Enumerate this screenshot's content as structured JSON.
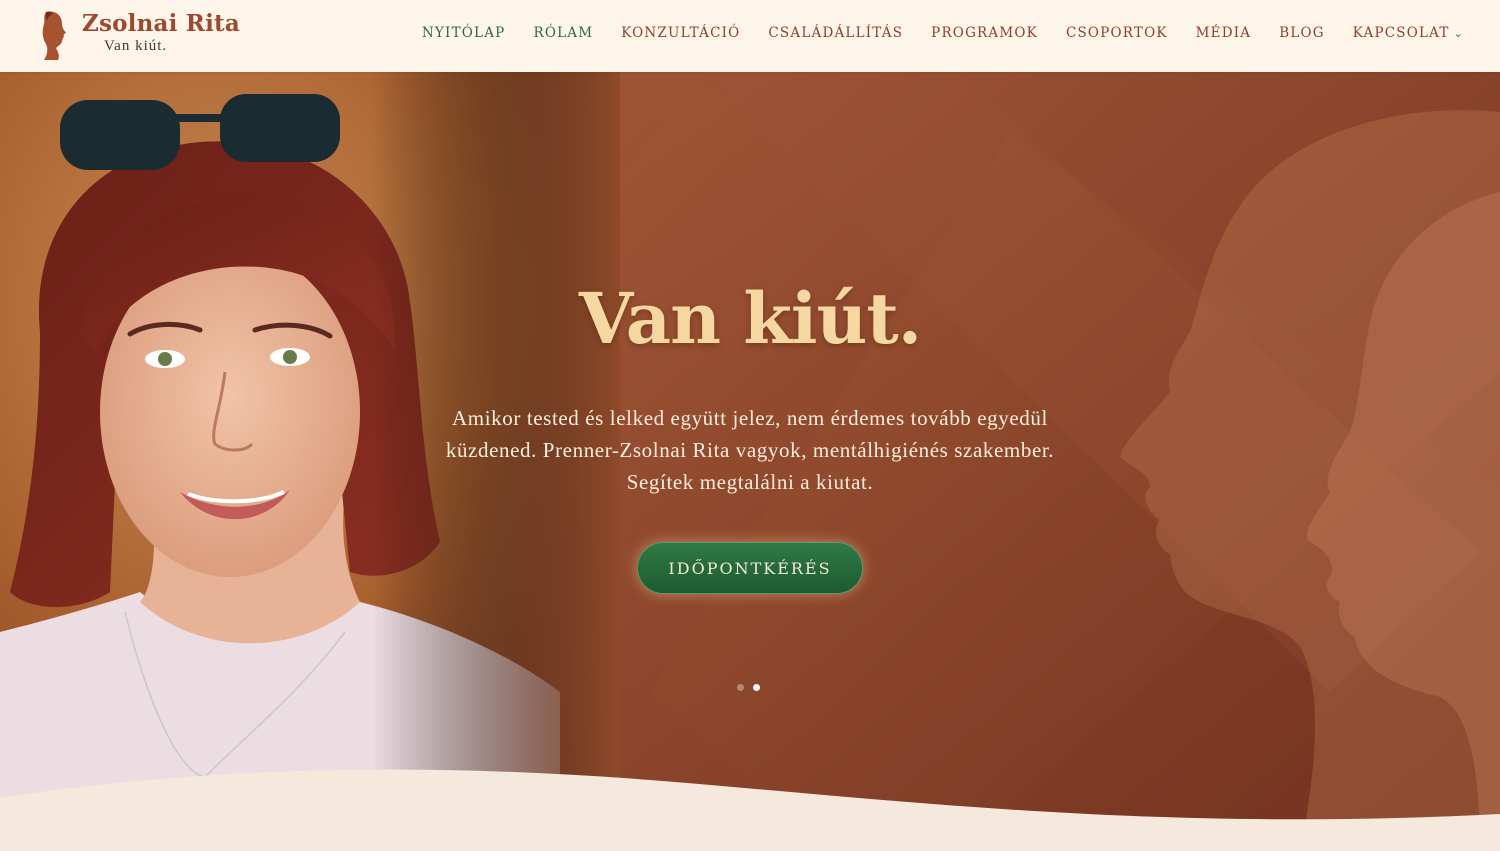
{
  "brand": {
    "title": "Zsolnai Rita",
    "tagline": "Van kiút."
  },
  "nav": {
    "items": [
      {
        "label": "NYITÓLAP"
      },
      {
        "label": "RÓLAM"
      },
      {
        "label": "KONZULTÁCIÓ"
      },
      {
        "label": "CSALÁDÁLLÍTÁS"
      },
      {
        "label": "PROGRAMOK"
      },
      {
        "label": "CSOPORTOK"
      },
      {
        "label": "MÉDIA"
      },
      {
        "label": "BLOG"
      },
      {
        "label": "KAPCSOLAT"
      }
    ]
  },
  "hero": {
    "title": "Van kiút.",
    "text": "Amikor tested és lelked együtt jelez, nem érdemes tovább egyedül küzdened. Prenner-Zsolnai Rita vagyok, mentálhigiénés szakember. Segítek megtalálni a kiutat.",
    "cta_label": "IDŐPONTKÉRÉS",
    "slider": {
      "total": 2,
      "active": 2
    }
  },
  "colors": {
    "accent": "#9b4a2f",
    "nav_active": "#2e6b3c",
    "hero_bg": "#8f4a2a",
    "title": "#f4d7a1",
    "cta": "#2f7a44",
    "wave": "#f5e9de"
  }
}
